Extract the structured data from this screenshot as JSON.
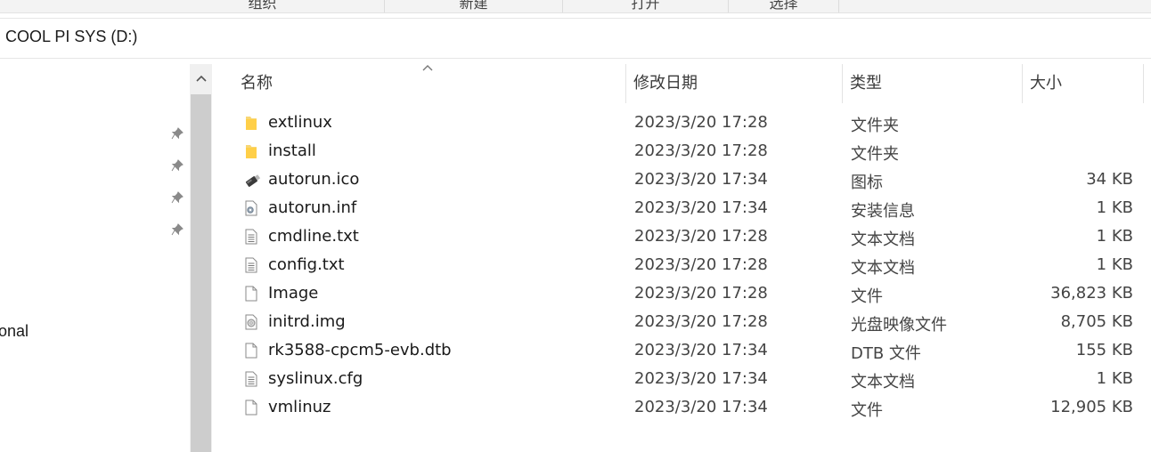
{
  "ribbon": {
    "groups": [
      {
        "label": "组织"
      },
      {
        "label": "新建"
      },
      {
        "label": "打开"
      },
      {
        "label": "选择"
      }
    ]
  },
  "address": {
    "path": "COOL PI SYS (D:)"
  },
  "nav": {
    "partial_item": "onal"
  },
  "columns": {
    "name": "名称",
    "date": "修改日期",
    "type": "类型",
    "size": "大小"
  },
  "files": [
    {
      "name": "extlinux",
      "date": "2023/3/20 17:28",
      "type": "文件夹",
      "size": "",
      "icon": "folder-icon"
    },
    {
      "name": "install",
      "date": "2023/3/20 17:28",
      "type": "文件夹",
      "size": "",
      "icon": "folder-icon"
    },
    {
      "name": "autorun.ico",
      "date": "2023/3/20 17:34",
      "type": "图标",
      "size": "34 KB",
      "icon": "usb-drive-icon"
    },
    {
      "name": "autorun.inf",
      "date": "2023/3/20 17:34",
      "type": "安装信息",
      "size": "1 KB",
      "icon": "setup-info-icon"
    },
    {
      "name": "cmdline.txt",
      "date": "2023/3/20 17:28",
      "type": "文本文档",
      "size": "1 KB",
      "icon": "text-document-icon"
    },
    {
      "name": "config.txt",
      "date": "2023/3/20 17:28",
      "type": "文本文档",
      "size": "1 KB",
      "icon": "text-document-icon"
    },
    {
      "name": "Image",
      "date": "2023/3/20 17:28",
      "type": "文件",
      "size": "36,823 KB",
      "icon": "file-icon"
    },
    {
      "name": "initrd.img",
      "date": "2023/3/20 17:28",
      "type": "光盘映像文件",
      "size": "8,705 KB",
      "icon": "disc-image-icon"
    },
    {
      "name": "rk3588-cpcm5-evb.dtb",
      "date": "2023/3/20 17:34",
      "type": "DTB 文件",
      "size": "155 KB",
      "icon": "file-icon"
    },
    {
      "name": "syslinux.cfg",
      "date": "2023/3/20 17:34",
      "type": "文本文档",
      "size": "1 KB",
      "icon": "text-document-icon"
    },
    {
      "name": "vmlinuz",
      "date": "2023/3/20 17:34",
      "type": "文件",
      "size": "12,905 KB",
      "icon": "file-icon"
    }
  ]
}
